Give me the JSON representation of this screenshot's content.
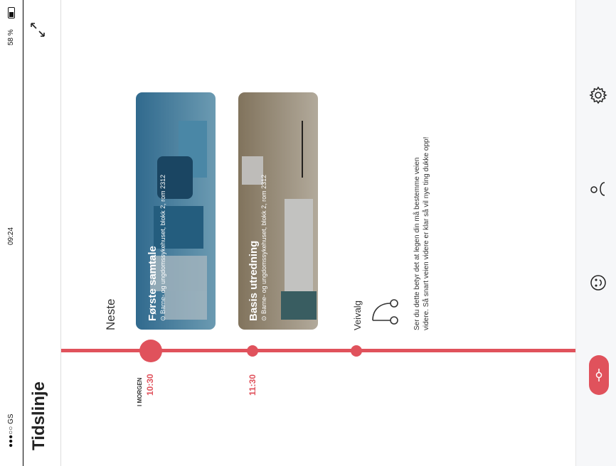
{
  "status": {
    "carrier": "●●●○○ GS",
    "time": "09:24",
    "battery": "58 %"
  },
  "header": {
    "title": "Tidslinje"
  },
  "section": {
    "next_label": "Neste"
  },
  "timeline": {
    "items": [
      {
        "day": "I MORGEN",
        "time": "10:30",
        "title": "Første samtale",
        "location": "Barne- og ungdomssykehuset, blokk 2, rom 2312"
      },
      {
        "day": "",
        "time": "11:30",
        "title": "Basis utredning",
        "location": "Barne- og ungdomssykehuset, blokk 2, rom 2312"
      }
    ],
    "choice": {
      "label": "Veivalg",
      "text_line1": "Ser du dette betyr det at legen din må bestemme veien",
      "text_line2": "videre. Så snart veien videre er klar så vil nye ting dukke opp!"
    }
  },
  "colors": {
    "accent": "#e0525c",
    "card1": "#4a8bb0",
    "card2": "#b8aa92"
  },
  "icons": [
    "expand-icon",
    "gear-icon",
    "person-icon",
    "smiley-icon",
    "timeline-icon",
    "location-pin-icon",
    "branch-icon"
  ]
}
